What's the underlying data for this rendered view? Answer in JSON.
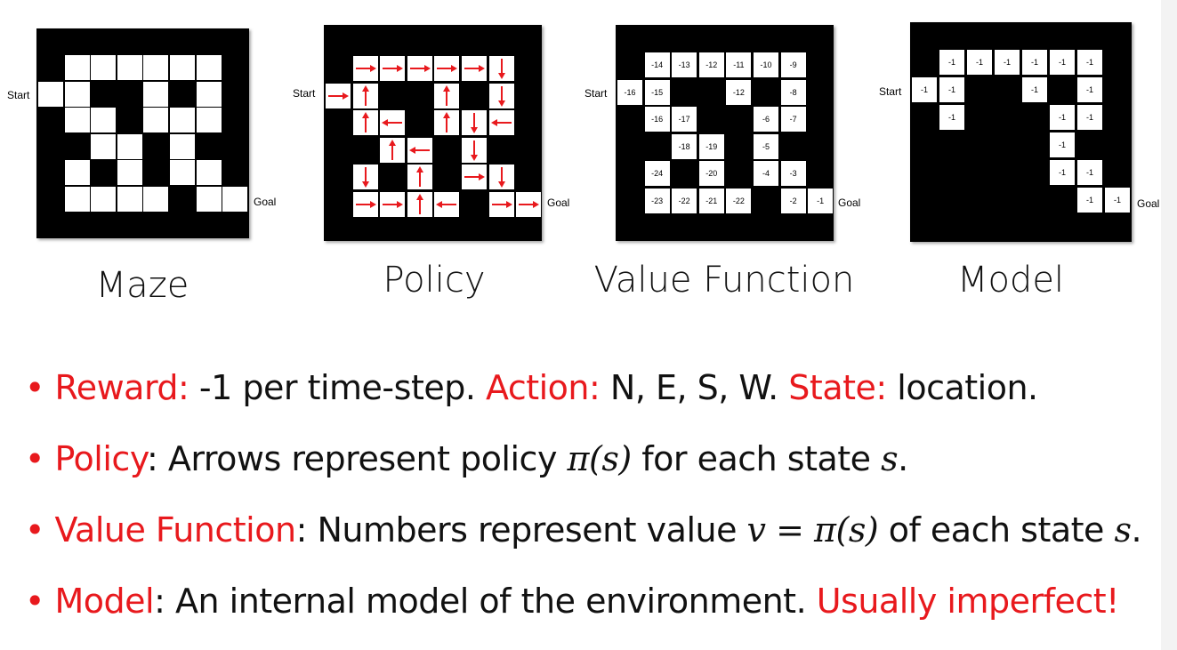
{
  "panels": {
    "maze": {
      "title": "Maze",
      "start_label": "Start",
      "goal_label": "Goal",
      "cells": [
        [
          1,
          0
        ],
        [
          2,
          0
        ],
        [
          3,
          0
        ],
        [
          4,
          0
        ],
        [
          5,
          0
        ],
        [
          6,
          0
        ],
        [
          0,
          1
        ],
        [
          1,
          1
        ],
        [
          4,
          1
        ],
        [
          6,
          1
        ],
        [
          1,
          2
        ],
        [
          2,
          2
        ],
        [
          4,
          2
        ],
        [
          5,
          2
        ],
        [
          6,
          2
        ],
        [
          2,
          3
        ],
        [
          3,
          3
        ],
        [
          5,
          3
        ],
        [
          1,
          4
        ],
        [
          3,
          4
        ],
        [
          5,
          4
        ],
        [
          6,
          4
        ],
        [
          1,
          5
        ],
        [
          2,
          5
        ],
        [
          3,
          5
        ],
        [
          4,
          5
        ],
        [
          6,
          5
        ],
        [
          7,
          5
        ]
      ]
    },
    "policy": {
      "title": "Policy",
      "start_label": "Start",
      "goal_label": "Goal",
      "arrow_color": "#e8191d",
      "cells": [
        {
          "c": 1,
          "r": 0,
          "dir": "E"
        },
        {
          "c": 2,
          "r": 0,
          "dir": "E"
        },
        {
          "c": 3,
          "r": 0,
          "dir": "E"
        },
        {
          "c": 4,
          "r": 0,
          "dir": "E"
        },
        {
          "c": 5,
          "r": 0,
          "dir": "E"
        },
        {
          "c": 6,
          "r": 0,
          "dir": "S"
        },
        {
          "c": 0,
          "r": 1,
          "dir": "E"
        },
        {
          "c": 1,
          "r": 1,
          "dir": "N"
        },
        {
          "c": 4,
          "r": 1,
          "dir": "N"
        },
        {
          "c": 6,
          "r": 1,
          "dir": "S"
        },
        {
          "c": 1,
          "r": 2,
          "dir": "N"
        },
        {
          "c": 2,
          "r": 2,
          "dir": "W"
        },
        {
          "c": 4,
          "r": 2,
          "dir": "N"
        },
        {
          "c": 5,
          "r": 2,
          "dir": "S"
        },
        {
          "c": 6,
          "r": 2,
          "dir": "W"
        },
        {
          "c": 2,
          "r": 3,
          "dir": "N"
        },
        {
          "c": 3,
          "r": 3,
          "dir": "W"
        },
        {
          "c": 5,
          "r": 3,
          "dir": "S"
        },
        {
          "c": 1,
          "r": 4,
          "dir": "S"
        },
        {
          "c": 3,
          "r": 4,
          "dir": "N"
        },
        {
          "c": 5,
          "r": 4,
          "dir": "E"
        },
        {
          "c": 6,
          "r": 4,
          "dir": "S"
        },
        {
          "c": 1,
          "r": 5,
          "dir": "E"
        },
        {
          "c": 2,
          "r": 5,
          "dir": "E"
        },
        {
          "c": 3,
          "r": 5,
          "dir": "N"
        },
        {
          "c": 4,
          "r": 5,
          "dir": "W"
        },
        {
          "c": 6,
          "r": 5,
          "dir": "E"
        },
        {
          "c": 7,
          "r": 5,
          "dir": "E"
        }
      ]
    },
    "value": {
      "title": "Value Function",
      "start_label": "Start",
      "goal_label": "Goal",
      "cells": [
        {
          "c": 1,
          "r": 0,
          "v": "-14"
        },
        {
          "c": 2,
          "r": 0,
          "v": "-13"
        },
        {
          "c": 3,
          "r": 0,
          "v": "-12"
        },
        {
          "c": 4,
          "r": 0,
          "v": "-11"
        },
        {
          "c": 5,
          "r": 0,
          "v": "-10"
        },
        {
          "c": 6,
          "r": 0,
          "v": "-9"
        },
        {
          "c": 0,
          "r": 1,
          "v": "-16"
        },
        {
          "c": 1,
          "r": 1,
          "v": "-15"
        },
        {
          "c": 4,
          "r": 1,
          "v": "-12"
        },
        {
          "c": 6,
          "r": 1,
          "v": "-8"
        },
        {
          "c": 1,
          "r": 2,
          "v": "-16"
        },
        {
          "c": 2,
          "r": 2,
          "v": "-17"
        },
        {
          "c": 5,
          "r": 2,
          "v": "-6"
        },
        {
          "c": 6,
          "r": 2,
          "v": "-7"
        },
        {
          "c": 2,
          "r": 3,
          "v": "-18"
        },
        {
          "c": 3,
          "r": 3,
          "v": "-19"
        },
        {
          "c": 5,
          "r": 3,
          "v": "-5"
        },
        {
          "c": 1,
          "r": 4,
          "v": "-24"
        },
        {
          "c": 3,
          "r": 4,
          "v": "-20"
        },
        {
          "c": 5,
          "r": 4,
          "v": "-4"
        },
        {
          "c": 6,
          "r": 4,
          "v": "-3"
        },
        {
          "c": 1,
          "r": 5,
          "v": "-23"
        },
        {
          "c": 2,
          "r": 5,
          "v": "-22"
        },
        {
          "c": 3,
          "r": 5,
          "v": "-21"
        },
        {
          "c": 4,
          "r": 5,
          "v": "-22"
        },
        {
          "c": 6,
          "r": 5,
          "v": "-2"
        },
        {
          "c": 7,
          "r": 5,
          "v": "-1"
        }
      ]
    },
    "model": {
      "title": "Model",
      "start_label": "Start",
      "goal_label": "Goal",
      "cells": [
        {
          "c": 1,
          "r": 0,
          "v": "-1"
        },
        {
          "c": 2,
          "r": 0,
          "v": "-1"
        },
        {
          "c": 3,
          "r": 0,
          "v": "-1"
        },
        {
          "c": 4,
          "r": 0,
          "v": "-1"
        },
        {
          "c": 5,
          "r": 0,
          "v": "-1"
        },
        {
          "c": 6,
          "r": 0,
          "v": "-1"
        },
        {
          "c": 0,
          "r": 1,
          "v": "-1"
        },
        {
          "c": 1,
          "r": 1,
          "v": "-1"
        },
        {
          "c": 4,
          "r": 1,
          "v": "-1"
        },
        {
          "c": 6,
          "r": 1,
          "v": "-1"
        },
        {
          "c": 1,
          "r": 2,
          "v": "-1"
        },
        {
          "c": 5,
          "r": 2,
          "v": "-1"
        },
        {
          "c": 6,
          "r": 2,
          "v": "-1"
        },
        {
          "c": 5,
          "r": 3,
          "v": "-1"
        },
        {
          "c": 5,
          "r": 4,
          "v": "-1"
        },
        {
          "c": 6,
          "r": 4,
          "v": "-1"
        },
        {
          "c": 6,
          "r": 5,
          "v": "-1"
        },
        {
          "c": 7,
          "r": 5,
          "v": "-1"
        }
      ]
    }
  },
  "bullets": [
    {
      "parts": [
        {
          "text": "• ",
          "style": "red"
        },
        {
          "text": "Reward:",
          "style": "red"
        },
        {
          "text": " -1  per time-step. ",
          "style": "plain"
        },
        {
          "text": "Action:",
          "style": "red"
        },
        {
          "text": " N, E, S, W. ",
          "style": "plain"
        },
        {
          "text": "State:",
          "style": "red"
        },
        {
          "text": " location.",
          "style": "plain"
        }
      ]
    },
    {
      "parts": [
        {
          "text": "• ",
          "style": "red"
        },
        {
          "text": "Policy",
          "style": "red"
        },
        {
          "text": ": Arrows represent policy ",
          "style": "plain"
        },
        {
          "text": "π(s)",
          "style": "math"
        },
        {
          "text": " for each state ",
          "style": "plain"
        },
        {
          "text": "s",
          "style": "math"
        },
        {
          "text": ".",
          "style": "plain"
        }
      ]
    },
    {
      "parts": [
        {
          "text": "• ",
          "style": "red"
        },
        {
          "text": "Value Function",
          "style": "red"
        },
        {
          "text": ": Numbers represent value ",
          "style": "plain"
        },
        {
          "text": "v = π(s)",
          "style": "math"
        },
        {
          "text": " of each state ",
          "style": "plain"
        },
        {
          "text": "s",
          "style": "math"
        },
        {
          "text": ".",
          "style": "plain"
        }
      ]
    },
    {
      "parts": [
        {
          "text": "• ",
          "style": "red"
        },
        {
          "text": "Model",
          "style": "red"
        },
        {
          "text": ": An internal model of the environment. ",
          "style": "plain"
        },
        {
          "text": "Usually imperfect!",
          "style": "red"
        }
      ]
    }
  ]
}
